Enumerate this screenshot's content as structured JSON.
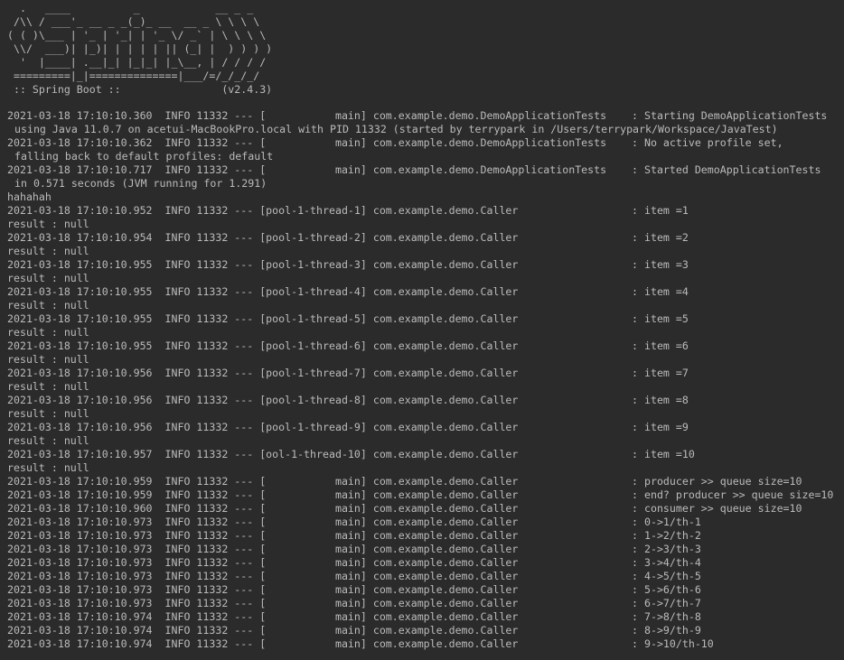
{
  "banner": {
    "art": [
      "  .   ____          _            __ _ _",
      " /\\\\ / ___'_ __ _ _(_)_ __  __ _ \\ \\ \\ \\",
      "( ( )\\___ | '_ | '_| | '_ \\/ _` | \\ \\ \\ \\",
      " \\\\/  ___)| |_)| | | | | || (_| |  ) ) ) )",
      "  '  |____| .__|_| |_|_| |_\\__, | / / / /",
      " =========|_|==============|___/=/_/_/_/",
      " :: Spring Boot ::                (v2.4.3)"
    ]
  },
  "log": {
    "lines": [
      {
        "text": "2021-03-18 17:10:10.360  INFO 11332 --- [           main] com.example.demo.DemoApplicationTests    : Starting DemoApplicationTests",
        "cont": false
      },
      {
        "text": "using Java 11.0.7 on acetui-MacBookPro.local with PID 11332 (started by terrypark in /Users/terrypark/Workspace/JavaTest)",
        "cont": true
      },
      {
        "text": "2021-03-18 17:10:10.362  INFO 11332 --- [           main] com.example.demo.DemoApplicationTests    : No active profile set,",
        "cont": false
      },
      {
        "text": "falling back to default profiles: default",
        "cont": true
      },
      {
        "text": "2021-03-18 17:10:10.717  INFO 11332 --- [           main] com.example.demo.DemoApplicationTests    : Started DemoApplicationTests",
        "cont": false
      },
      {
        "text": "in 0.571 seconds (JVM running for 1.291)",
        "cont": true
      },
      {
        "text": "hahahah",
        "cont": false
      },
      {
        "text": "2021-03-18 17:10:10.952  INFO 11332 --- [pool-1-thread-1] com.example.demo.Caller                  : item =1",
        "cont": false
      },
      {
        "text": "result : null",
        "cont": false
      },
      {
        "text": "2021-03-18 17:10:10.954  INFO 11332 --- [pool-1-thread-2] com.example.demo.Caller                  : item =2",
        "cont": false
      },
      {
        "text": "result : null",
        "cont": false
      },
      {
        "text": "2021-03-18 17:10:10.955  INFO 11332 --- [pool-1-thread-3] com.example.demo.Caller                  : item =3",
        "cont": false
      },
      {
        "text": "result : null",
        "cont": false
      },
      {
        "text": "2021-03-18 17:10:10.955  INFO 11332 --- [pool-1-thread-4] com.example.demo.Caller                  : item =4",
        "cont": false
      },
      {
        "text": "result : null",
        "cont": false
      },
      {
        "text": "2021-03-18 17:10:10.955  INFO 11332 --- [pool-1-thread-5] com.example.demo.Caller                  : item =5",
        "cont": false
      },
      {
        "text": "result : null",
        "cont": false
      },
      {
        "text": "2021-03-18 17:10:10.955  INFO 11332 --- [pool-1-thread-6] com.example.demo.Caller                  : item =6",
        "cont": false
      },
      {
        "text": "result : null",
        "cont": false
      },
      {
        "text": "2021-03-18 17:10:10.956  INFO 11332 --- [pool-1-thread-7] com.example.demo.Caller                  : item =7",
        "cont": false
      },
      {
        "text": "result : null",
        "cont": false
      },
      {
        "text": "2021-03-18 17:10:10.956  INFO 11332 --- [pool-1-thread-8] com.example.demo.Caller                  : item =8",
        "cont": false
      },
      {
        "text": "result : null",
        "cont": false
      },
      {
        "text": "2021-03-18 17:10:10.956  INFO 11332 --- [pool-1-thread-9] com.example.demo.Caller                  : item =9",
        "cont": false
      },
      {
        "text": "result : null",
        "cont": false
      },
      {
        "text": "2021-03-18 17:10:10.957  INFO 11332 --- [ool-1-thread-10] com.example.demo.Caller                  : item =10",
        "cont": false
      },
      {
        "text": "result : null",
        "cont": false
      },
      {
        "text": "2021-03-18 17:10:10.959  INFO 11332 --- [           main] com.example.demo.Caller                  : producer >> queue size=10",
        "cont": false
      },
      {
        "text": "2021-03-18 17:10:10.959  INFO 11332 --- [           main] com.example.demo.Caller                  : end? producer >> queue size=10",
        "cont": false
      },
      {
        "text": "2021-03-18 17:10:10.960  INFO 11332 --- [           main] com.example.demo.Caller                  : consumer >> queue size=10",
        "cont": false
      },
      {
        "text": "2021-03-18 17:10:10.973  INFO 11332 --- [           main] com.example.demo.Caller                  : 0->1/th-1",
        "cont": false
      },
      {
        "text": "2021-03-18 17:10:10.973  INFO 11332 --- [           main] com.example.demo.Caller                  : 1->2/th-2",
        "cont": false
      },
      {
        "text": "2021-03-18 17:10:10.973  INFO 11332 --- [           main] com.example.demo.Caller                  : 2->3/th-3",
        "cont": false
      },
      {
        "text": "2021-03-18 17:10:10.973  INFO 11332 --- [           main] com.example.demo.Caller                  : 3->4/th-4",
        "cont": false
      },
      {
        "text": "2021-03-18 17:10:10.973  INFO 11332 --- [           main] com.example.demo.Caller                  : 4->5/th-5",
        "cont": false
      },
      {
        "text": "2021-03-18 17:10:10.973  INFO 11332 --- [           main] com.example.demo.Caller                  : 5->6/th-6",
        "cont": false
      },
      {
        "text": "2021-03-18 17:10:10.973  INFO 11332 --- [           main] com.example.demo.Caller                  : 6->7/th-7",
        "cont": false
      },
      {
        "text": "2021-03-18 17:10:10.974  INFO 11332 --- [           main] com.example.demo.Caller                  : 7->8/th-8",
        "cont": false
      },
      {
        "text": "2021-03-18 17:10:10.974  INFO 11332 --- [           main] com.example.demo.Caller                  : 8->9/th-9",
        "cont": false
      },
      {
        "text": "2021-03-18 17:10:10.974  INFO 11332 --- [           main] com.example.demo.Caller                  : 9->10/th-10",
        "cont": false
      }
    ]
  },
  "colors": {
    "background": "#2b2b2b",
    "text": "#bbbbbb"
  }
}
